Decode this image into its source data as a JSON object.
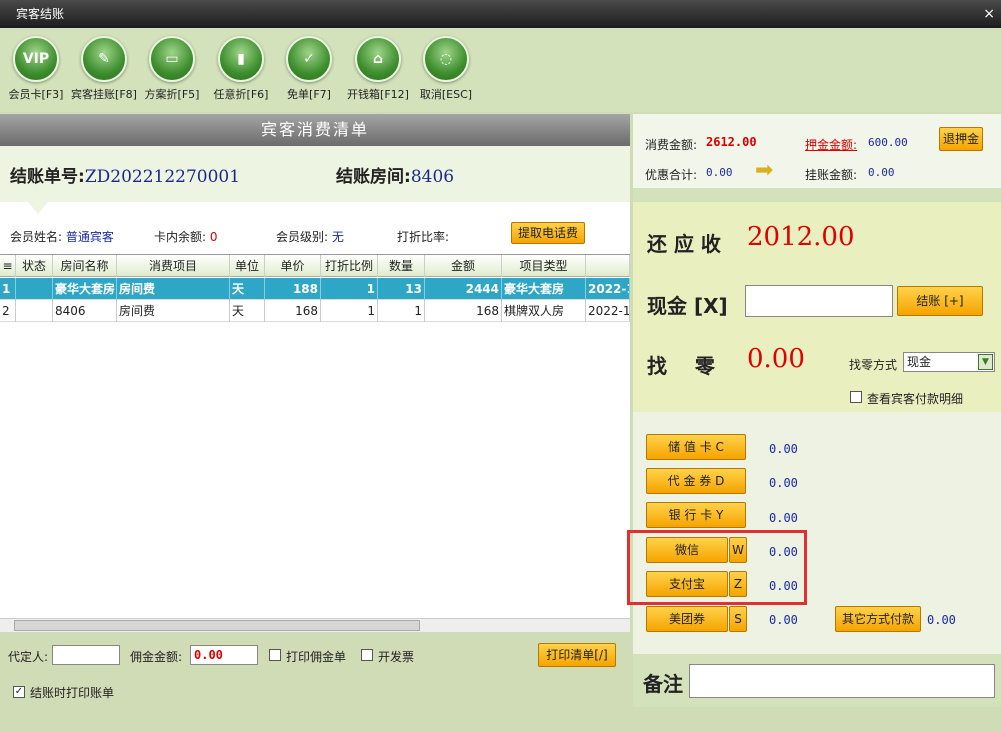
{
  "window": {
    "title": "宾客结账",
    "close_glyph": "×"
  },
  "toolbar": [
    {
      "icon": "vip-icon",
      "glyph": "VIP",
      "label": "会员卡[F3]"
    },
    {
      "icon": "guest-charge-icon",
      "glyph": "✎",
      "label": "宾客挂账[F8]"
    },
    {
      "icon": "plan-discount-icon",
      "glyph": "▭",
      "label": "方案折[F5]"
    },
    {
      "icon": "any-discount-icon",
      "glyph": "▮",
      "label": "任意折[F6]"
    },
    {
      "icon": "free-bill-icon",
      "glyph": "✓",
      "label": "免单[F7]"
    },
    {
      "icon": "cash-drawer-icon",
      "glyph": "⌂",
      "label": "开钱箱[F12]"
    },
    {
      "icon": "cancel-icon",
      "glyph": "◌",
      "label": "取消[ESC]"
    }
  ],
  "consume": {
    "header": "宾客消费清单",
    "bill_no_label": "结账单号:",
    "bill_no": "ZD202212270001",
    "room_label": "结账房间:",
    "room": "8406",
    "member_name_label": "会员姓名:",
    "member_name": "普通宾客",
    "balance_label": "卡内余额:",
    "balance": "0",
    "level_label": "会员级别:",
    "level": "无",
    "discount_label": "打折比率:",
    "phone_fee_button": "提取电话费"
  },
  "grid": {
    "headers": [
      "状态",
      "房间名称",
      "消费项目",
      "单位",
      "单价",
      "打折比例",
      "数量",
      "金额",
      "项目类型",
      ""
    ],
    "rows": [
      {
        "no": "1",
        "status": "",
        "room": "豪华大套房",
        "item": "房间费",
        "unit": "天",
        "price": "188",
        "discount": "1",
        "qty": "13",
        "amount": "2444",
        "type": "豪华大套房",
        "date": "2022-1"
      },
      {
        "no": "2",
        "status": "",
        "room": "8406",
        "item": "房间费",
        "unit": "天",
        "price": "168",
        "discount": "1",
        "qty": "1",
        "amount": "168",
        "type": "棋牌双人房",
        "date": "2022-12"
      }
    ]
  },
  "bottom": {
    "agent_label": "代定人:",
    "commission_label": "佣金金额:",
    "commission_value": "0.00",
    "print_commission": "打印佣金单",
    "invoice": "开发票",
    "print_list_button": "打印清单[/]",
    "print_on_checkout": "结账时打印账单"
  },
  "summary": {
    "consume_label": "消费金额:",
    "consume_value": "2612.00",
    "deposit_label": "押金金额:",
    "deposit_value": "600.00",
    "refund_deposit_button": "退押金",
    "discount_label": "优惠合计:",
    "discount_value": "0.00",
    "charge_label": "挂账金额:",
    "charge_value": "0.00"
  },
  "receive": {
    "due_label": "还 应 收",
    "due_value": "2012.00",
    "cash_label": "现金 [X]",
    "cash_value": "",
    "checkout_button": "结账 [+]",
    "change_label": "找    零",
    "change_value": "0.00",
    "change_method_label": "找零方式",
    "change_method": "现金",
    "view_detail": "查看宾客付款明细"
  },
  "payments": [
    {
      "label": "储 值 卡 C",
      "key": "",
      "value": "0.00"
    },
    {
      "label": "代 金 券 D",
      "key": "",
      "value": "0.00"
    },
    {
      "label": "银 行 卡 Y",
      "key": "",
      "value": "0.00"
    },
    {
      "label": "微信",
      "key": "W",
      "value": "0.00"
    },
    {
      "label": "支付宝",
      "key": "Z",
      "value": "0.00"
    },
    {
      "label": "美团券",
      "key": "S",
      "value": "0.00"
    }
  ],
  "other_payment": {
    "label": "其它方式付款",
    "value": "0.00"
  },
  "note": {
    "label": "备注",
    "value": ""
  },
  "colors": {
    "highlight_box": "#e03030",
    "accent_red": "#e00000",
    "value_blue": "#1a2aa8",
    "selected_row": "#2ea7c7"
  }
}
